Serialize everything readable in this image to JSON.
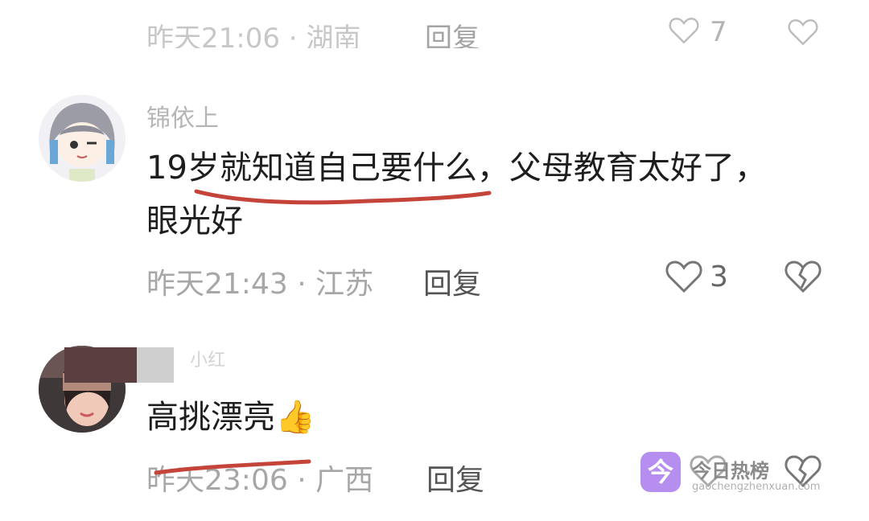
{
  "top_partial": {
    "meta": "昨天21:06 · 湖南",
    "reply": "回复",
    "like_count": "7"
  },
  "comments": [
    {
      "username": "锦依上",
      "text_line1": "19岁就知道自己要什么，父母教育太好了，",
      "text_line2": "眼光好",
      "meta": "昨天21:43 · 江苏",
      "reply": "回复",
      "like_count": "3"
    },
    {
      "username": "小红",
      "text": "高挑漂亮",
      "emoji": "👍",
      "meta": "昨天23:06 · 广西",
      "reply": "回复",
      "like_count": ""
    }
  ],
  "watermark": {
    "logo": "今",
    "title": "今日热榜",
    "url": "gaochengzhenxuan.com"
  },
  "colors": {
    "underline": "#c4443a",
    "watermark": "#b58ef0"
  }
}
